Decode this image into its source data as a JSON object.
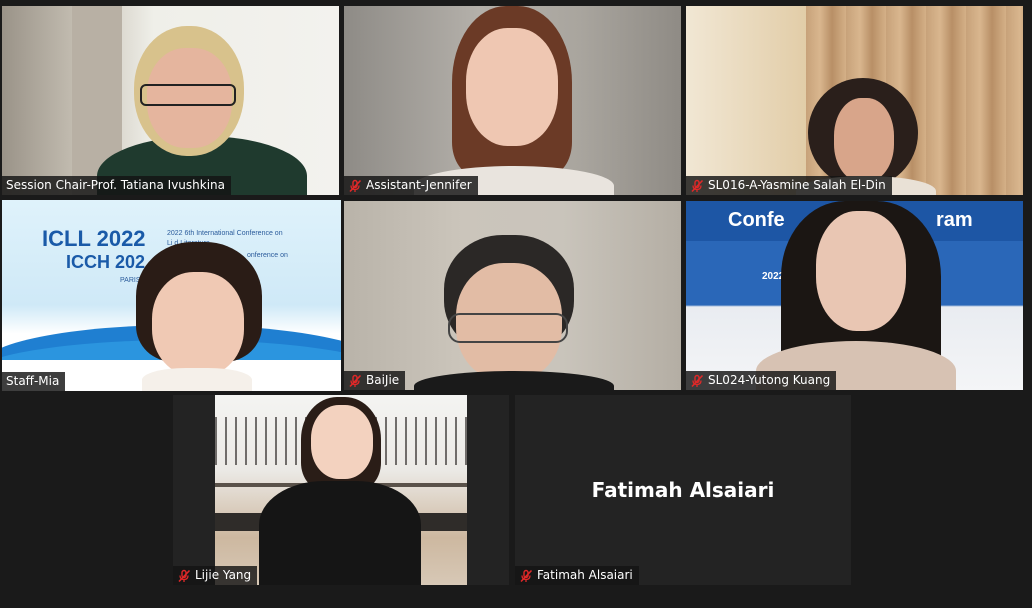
{
  "participants": [
    {
      "name": "Session Chair-Prof. Tatiana Ivushkina",
      "muted": false
    },
    {
      "name": "Assistant-Jennifer",
      "muted": true
    },
    {
      "name": "SL016-A-Yasmine Salah El-Din",
      "muted": true
    },
    {
      "name": "Staff-Mia",
      "muted": false,
      "active": true
    },
    {
      "name": "BaiJie",
      "muted": true
    },
    {
      "name": "SL024-Yutong Kuang",
      "muted": true
    },
    {
      "name": "Lijie Yang",
      "muted": true
    },
    {
      "name": "Fatimah Alsaiari",
      "muted": true,
      "video_off": true
    }
  ],
  "background_texts": {
    "icll": "ICLL 2022",
    "icch": "ICCH 202",
    "conf_line1": "2022 6th International Conference on",
    "conf_line2": "Li          d Literature",
    "conf_line3": "onference on",
    "paris": "PARIS",
    "conf_banner": "Confe",
    "conf_banner_right": "ram",
    "year_small": "2022"
  },
  "colors": {
    "active_border": "#e7e36a",
    "mute_icon": "#e02828",
    "tile_bg": "#232323"
  }
}
